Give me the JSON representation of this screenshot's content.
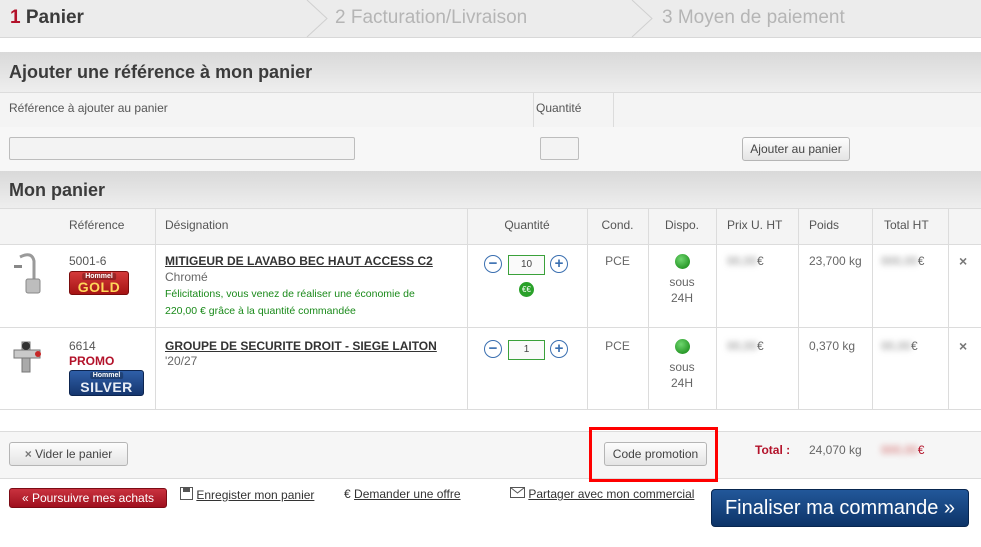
{
  "steps": [
    {
      "num": "1",
      "label": "Panier"
    },
    {
      "num": "2",
      "label": "Facturation/Livraison"
    },
    {
      "num": "3",
      "label": "Moyen de paiement"
    }
  ],
  "add_section": {
    "title": "Ajouter une référence à mon panier",
    "ref_header": "Référence à ajouter au panier",
    "qty_header": "Quantité",
    "add_button": "Ajouter au panier"
  },
  "cart": {
    "title": "Mon panier",
    "headers": {
      "reference": "Référence",
      "designation": "Désignation",
      "quantite": "Quantité",
      "cond": "Cond.",
      "dispo": "Dispo.",
      "prix": "Prix U. HT",
      "poids": "Poids",
      "total": "Total HT"
    },
    "items": [
      {
        "ref": "5001-6",
        "badge": {
          "brand": "Hommel",
          "level": "GOLD"
        },
        "promo": "",
        "name": "MITIGEUR DE LAVABO BEC HAUT ACCESS C2",
        "sub": "Chromé",
        "note": "Félicitations, vous venez de réaliser une économie de 220,00 € grâce à la quantité commandée",
        "qty": "10",
        "cond": "PCE",
        "dispo": "sous 24H",
        "price": "€",
        "weight": "23,700 kg",
        "total": "€"
      },
      {
        "ref": "6614",
        "badge": {
          "brand": "Hommel",
          "level": "SILVER"
        },
        "promo": "PROMO",
        "name": "GROUPE DE SECURITE DROIT - SIEGE LAITON",
        "sub": "'20/27",
        "note": "",
        "qty": "1",
        "cond": "PCE",
        "dispo": "sous 24H",
        "price": "€",
        "weight": "0,370 kg",
        "total": "€"
      }
    ],
    "clear_button": "Vider le panier",
    "promo_button": "Code promotion",
    "total_label": "Total :",
    "total_weight": "24,070 kg",
    "total_amount": "€"
  },
  "footer": {
    "continue_button": "« Poursuivre mes achats",
    "save_link": "Enregister mon panier",
    "offer_link": "Demander une offre",
    "share_link": "Partager avec mon commercial",
    "finalize_button": "Finaliser ma commande »"
  },
  "colors": {
    "accent_red": "#b3122a",
    "primary_blue": "#0d3468",
    "available_green": "#2a9a2a",
    "highlight": "#ff0000"
  }
}
